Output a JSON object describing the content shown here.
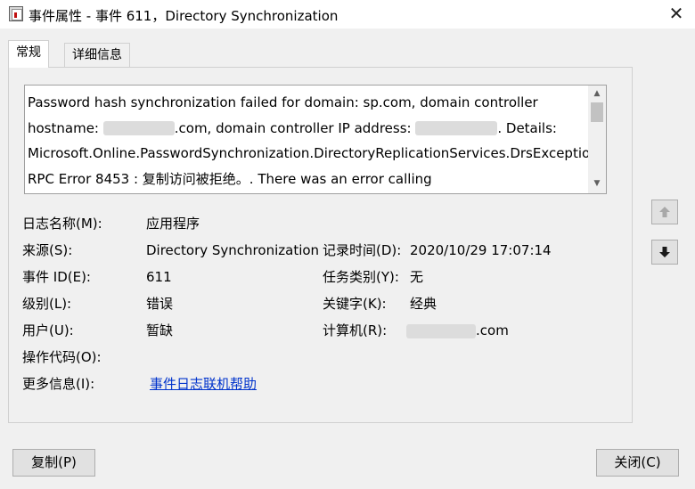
{
  "window": {
    "title": "事件属性 - 事件 611，Directory Synchronization",
    "close_glyph": "✕"
  },
  "tabs": [
    {
      "label": "常规",
      "active": true
    },
    {
      "label": "详细信息",
      "active": false
    }
  ],
  "description": {
    "line1": "Password hash synchronization failed for domain: sp.com, domain controller",
    "line2_a": "hostname: ",
    "line2_b": ".com, domain controller IP address: ",
    "line2_c": ". Details:",
    "line3": "Microsoft.Online.PasswordSynchronization.DirectoryReplicationServices.DrsException:",
    "line4": "RPC Error 8453 : 复制访问被拒绝。. There was an error calling"
  },
  "fields": {
    "log_name_label": "日志名称(M):",
    "log_name_value": "应用程序",
    "source_label": "来源(S):",
    "source_value": "Directory Synchronization",
    "logged_label": "记录时间(D):",
    "logged_value": "2020/10/29 17:07:14",
    "event_id_label": "事件 ID(E):",
    "event_id_value": "611",
    "task_category_label": "任务类别(Y):",
    "task_category_value": "无",
    "level_label": "级别(L):",
    "level_value": "错误",
    "keywords_label": "关键字(K):",
    "keywords_value": "经典",
    "user_label": "用户(U):",
    "user_value": "暂缺",
    "computer_label": "计算机(R):",
    "computer_value_suffix": ".com",
    "opcode_label": "操作代码(O):",
    "more_info_label": "更多信息(I):",
    "more_info_link": "事件日志联机帮助"
  },
  "buttons": {
    "copy": "复制(P)",
    "close": "关闭(C)"
  },
  "icons": {
    "scroll_up": "▲",
    "scroll_down": "▼"
  }
}
